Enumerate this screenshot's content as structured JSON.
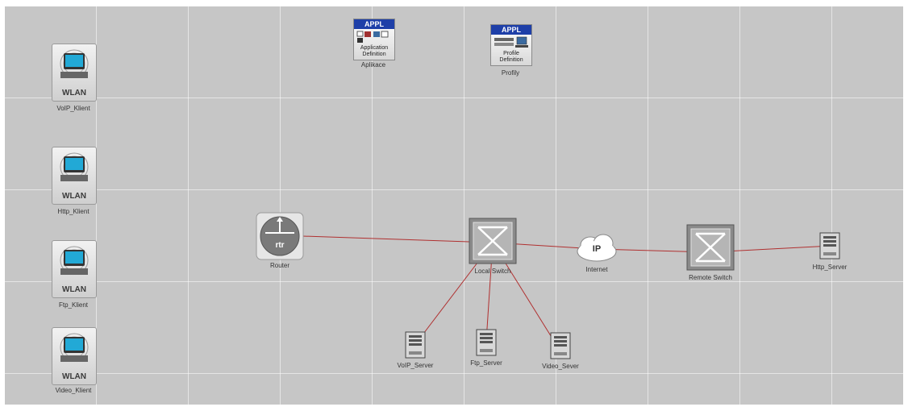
{
  "nodes": {
    "voip_client": {
      "name": "VoIP_Klient",
      "tag": "WLAN"
    },
    "http_client": {
      "name": "Http_Klient",
      "tag": "WLAN"
    },
    "ftp_client": {
      "name": "Ftp_Klient",
      "tag": "WLAN"
    },
    "video_client": {
      "name": "Video_Klient",
      "tag": "WLAN"
    },
    "app_def": {
      "name": "Aplikace",
      "badge": "APPL",
      "caption": "Application Definition"
    },
    "profile_def": {
      "name": "Profily",
      "badge": "APPL",
      "caption": "Profile Definition"
    },
    "router": {
      "name": "Router",
      "glyph": "rtr"
    },
    "local_switch": {
      "name": "Local Switch"
    },
    "internet": {
      "name": "Internet",
      "glyph": "IP"
    },
    "remote_switch": {
      "name": "Remote Switch"
    },
    "http_server": {
      "name": "Http_Server"
    },
    "voip_server": {
      "name": "VoIP_Server"
    },
    "ftp_server": {
      "name": "Ftp_Server"
    },
    "video_server": {
      "name": "Video_Sever"
    }
  },
  "links": [
    {
      "from": "router",
      "to": "local_switch"
    },
    {
      "from": "local_switch",
      "to": "internet"
    },
    {
      "from": "internet",
      "to": "remote_switch"
    },
    {
      "from": "remote_switch",
      "to": "http_server"
    },
    {
      "from": "local_switch",
      "to": "voip_server"
    },
    {
      "from": "local_switch",
      "to": "ftp_server"
    },
    {
      "from": "local_switch",
      "to": "video_server"
    }
  ],
  "colors": {
    "canvas": "#c6c6c6",
    "link": "#b03030",
    "appl_header": "#1e3fa8",
    "monitor": "#22a9d6"
  }
}
